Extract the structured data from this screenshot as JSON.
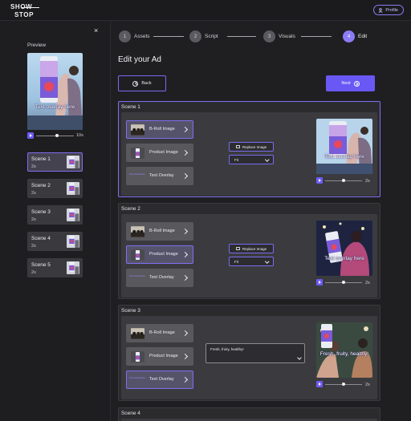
{
  "brand": {
    "line1": "SHOW",
    "line2": "STOP"
  },
  "header": {
    "profile_label": "Profile"
  },
  "sidebar": {
    "close_glyph": "×",
    "preview_label": "Preview",
    "preview_overlay": "Text overlay here",
    "preview_duration": "10s",
    "preview_progress": 0.55,
    "scenes": [
      {
        "title": "Scene 1",
        "duration": "2s",
        "active": true
      },
      {
        "title": "Scene 2",
        "duration": "2s",
        "active": false
      },
      {
        "title": "Scene 3",
        "duration": "2s",
        "active": false
      },
      {
        "title": "Scene 4",
        "duration": "2s",
        "active": false
      },
      {
        "title": "Scene 5",
        "duration": "2s",
        "active": false
      }
    ]
  },
  "steps": [
    {
      "num": "1",
      "label": "Assets",
      "active": false
    },
    {
      "num": "2",
      "label": "Script",
      "active": false
    },
    {
      "num": "3",
      "label": "Visuals",
      "active": false
    },
    {
      "num": "4",
      "label": "Edit",
      "active": true
    }
  ],
  "page_title": "Edit your Ad",
  "nav": {
    "back_label": "Back",
    "next_label": "Next"
  },
  "elements": {
    "broll_label": "B-Roll Image",
    "product_label": "Product Image",
    "text_overlay_label": "Text Overlay",
    "text_overlay_icon_text": "Text overlay here"
  },
  "controls": {
    "replace_label": "Replace Image",
    "fit_value": "Fit"
  },
  "scenes": [
    {
      "title": "Scene 1",
      "active_element": "broll",
      "overlay": "Text overlay here",
      "duration": "2s",
      "progress": 0.5
    },
    {
      "title": "Scene 2",
      "active_element": "product",
      "overlay": "Text overlay here",
      "duration": "2s",
      "progress": 0.5
    },
    {
      "title": "Scene 3",
      "active_element": "text",
      "overlay": "Fresh, fruity, healthy!",
      "text_value": "Fresh, fruity, healthy!",
      "duration": "2s",
      "progress": 0.5
    }
  ],
  "scene4_title": "Scene 4",
  "colors": {
    "accent": "#6a58f5",
    "accent_border": "#7e6ff2",
    "bg": "#1f1f22"
  }
}
